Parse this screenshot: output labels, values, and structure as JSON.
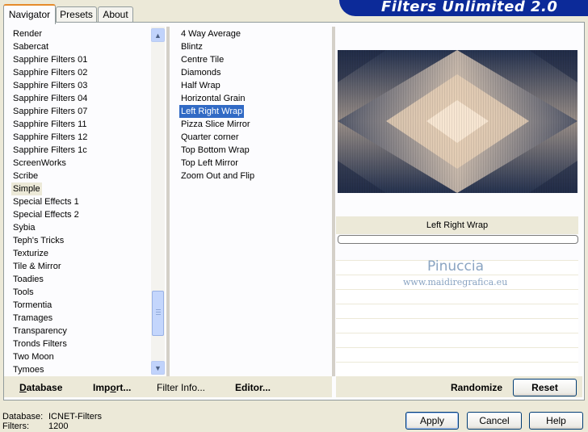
{
  "tabs": [
    {
      "label": "Navigator",
      "active": true
    },
    {
      "label": "Presets",
      "active": false
    },
    {
      "label": "About",
      "active": false
    }
  ],
  "banner_title": "Filters Unlimited 2.0",
  "categories": [
    "Render",
    "Sabercat",
    "Sapphire Filters 01",
    "Sapphire Filters 02",
    "Sapphire Filters 03",
    "Sapphire Filters 04",
    "Sapphire Filters 07",
    "Sapphire Filters 11",
    "Sapphire Filters 12",
    "Sapphire Filters 1c",
    "ScreenWorks",
    "Scribe",
    "Simple",
    "Special Effects 1",
    "Special Effects 2",
    "Sybia",
    "Teph's Tricks",
    "Texturize",
    "Tile & Mirror",
    "Toadies",
    "Tools",
    "Tormentia",
    "Tramages",
    "Transparency",
    "Tronds Filters",
    "Two Moon",
    "Tymoes"
  ],
  "selected_category": "Simple",
  "filters": [
    "4 Way Average",
    "Blintz",
    "Centre Tile",
    "Diamonds",
    "Half Wrap",
    "Horizontal Grain",
    "Left Right Wrap",
    "Pizza Slice Mirror",
    "Quarter corner",
    "Top Bottom Wrap",
    "Top Left Mirror",
    "Zoom Out and Flip"
  ],
  "selected_filter": "Left Right Wrap",
  "preview_filter_label": "Left Right Wrap",
  "watermark": {
    "name": "Pinuccia",
    "url": "www.maidiregrafica.eu"
  },
  "bottom_links": {
    "database": "Database",
    "import": "Import...",
    "filter_info": "Filter Info...",
    "editor": "Editor..."
  },
  "randomize_label": "Randomize",
  "reset_label": "Reset",
  "status": {
    "database_label": "Database:",
    "database_value": "ICNET-Filters",
    "filters_label": "Filters:",
    "filters_value": "1200"
  },
  "buttons": {
    "apply": "Apply",
    "cancel": "Cancel",
    "help": "Help"
  },
  "icons": {
    "scroll_up": "chevron-up-icon",
    "scroll_down": "chevron-down-icon"
  },
  "colors": {
    "selection": "#316ac5",
    "banner": "#0c2a99",
    "face": "#ece9d8"
  }
}
